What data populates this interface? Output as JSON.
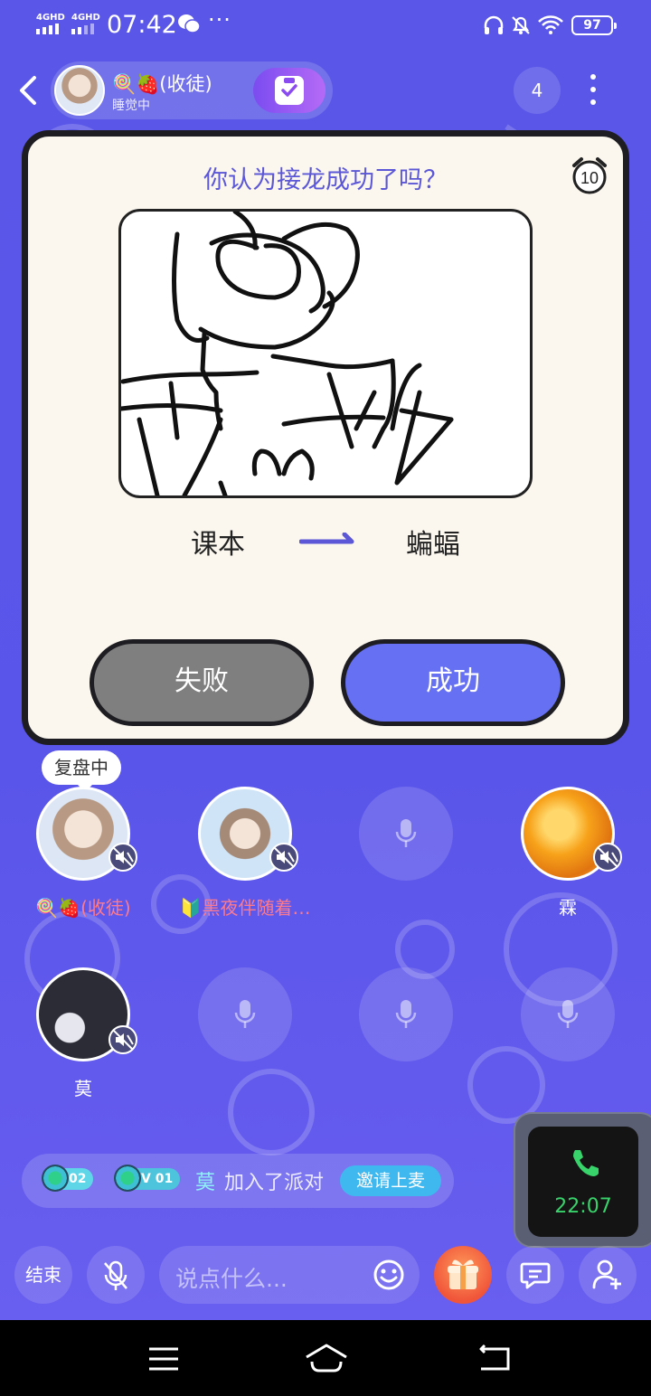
{
  "status_bar": {
    "network_1": "4GHD",
    "network_2": "4GHD",
    "time": "07:42",
    "more": "···",
    "battery": "97"
  },
  "header": {
    "room_name": "🍭🍓(收徒)",
    "room_status": "睡觉中",
    "online_count": "4"
  },
  "game_card": {
    "question": "你认为接龙成功了吗？",
    "timer": "10",
    "word_from": "课本",
    "word_to": "蝙蝠",
    "fail_label": "失败",
    "success_label": "成功"
  },
  "seats": {
    "tooltip": "复盘中",
    "seat1_name": "🍭🍓(收徒)",
    "seat2_name": "🔰黑夜伴随着…",
    "seat4_name": "霖",
    "seat5_name": "莫"
  },
  "join_message": {
    "level_badge_1": "02",
    "level_badge_2": "V 01",
    "user": "莫",
    "text": "加入了派对",
    "invite_label": "邀请上麦"
  },
  "call_widget": {
    "duration": "22:07"
  },
  "bottom_bar": {
    "end_label": "结束",
    "input_placeholder": "说点什么..."
  },
  "colors": {
    "background": "#5a57e8",
    "accent": "#6670f2",
    "question_text": "#5b57d6",
    "name_pink": "#ff7a8a",
    "call_green": "#39d36b"
  }
}
